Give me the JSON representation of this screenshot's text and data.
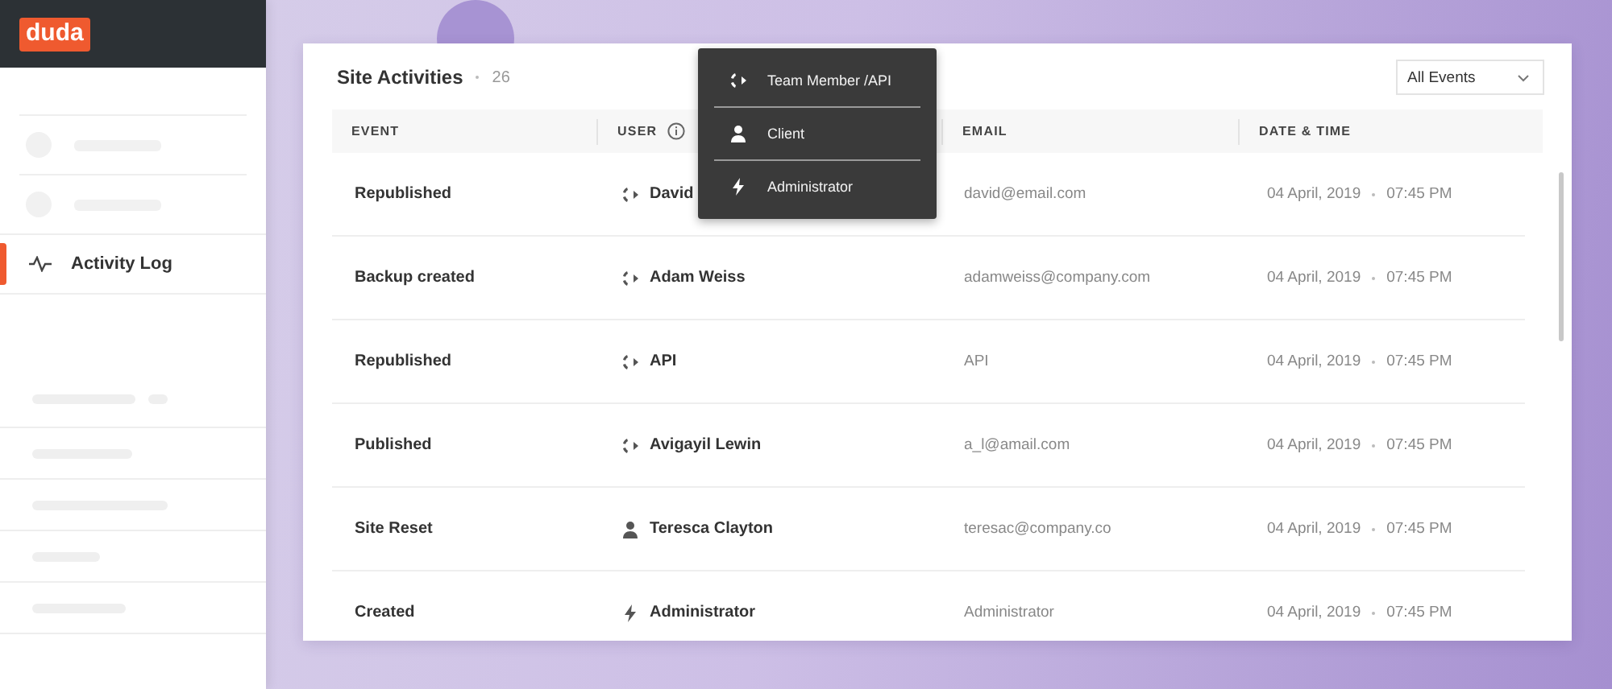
{
  "logo": "duda",
  "sidebar": {
    "items": [
      {
        "kind": "skeleton"
      },
      {
        "kind": "skeleton"
      },
      {
        "kind": "link",
        "label": "Activity Log",
        "selected": true
      }
    ]
  },
  "panel": {
    "title": "Site Activities",
    "count": "26",
    "filter": {
      "value": "All Events"
    }
  },
  "table": {
    "columns": [
      {
        "label": "EVENT",
        "info": false
      },
      {
        "label": "USER",
        "info": true
      },
      {
        "label": "EMAIL",
        "info": false
      },
      {
        "label": "DATE & TIME",
        "info": false
      }
    ],
    "rows": [
      {
        "event": "Republished",
        "user": "David",
        "kind": "team",
        "email": "david@email.com",
        "date": "04 April, 2019",
        "time": "07:45 PM"
      },
      {
        "event": "Backup created",
        "user": "Adam Weiss",
        "kind": "team",
        "email": "adamweiss@company.com",
        "date": "04 April, 2019",
        "time": "07:45 PM"
      },
      {
        "event": "Republished",
        "user": "API",
        "kind": "team",
        "email": "API",
        "date": "04 April, 2019",
        "time": "07:45 PM"
      },
      {
        "event": "Published",
        "user": "Avigayil Lewin",
        "kind": "team",
        "email": "a_l@amail.com",
        "date": "04 April, 2019",
        "time": "07:45 PM"
      },
      {
        "event": "Site Reset",
        "user": "Teresca Clayton",
        "kind": "client",
        "email": "teresac@company.co",
        "date": "04 April, 2019",
        "time": "07:45 PM"
      },
      {
        "event": "Created",
        "user": "Administrator",
        "kind": "admin",
        "email": "Administrator",
        "date": "04 April, 2019",
        "time": "07:45 PM"
      }
    ]
  },
  "legend_menu": {
    "items": [
      {
        "kind": "team",
        "label": "Team Member /API"
      },
      {
        "kind": "client",
        "label": "Client"
      },
      {
        "kind": "admin",
        "label": "Administrator"
      }
    ]
  }
}
